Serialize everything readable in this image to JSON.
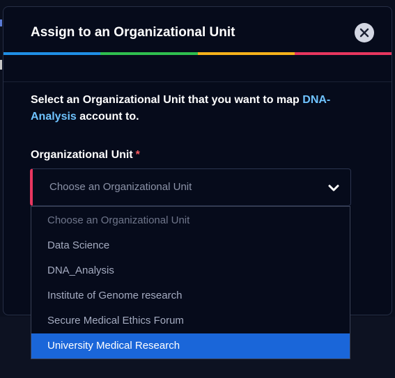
{
  "modal": {
    "title": "Assign to an Organizational Unit",
    "close_icon": "close-icon",
    "accent_colors": [
      "#1f8fe6",
      "#2fbf4f",
      "#f5b21b",
      "#e8365f"
    ],
    "description_prefix": "Select an Organizational Unit that you want to map ",
    "account_name": "DNA-Analysis",
    "description_suffix": " account to."
  },
  "field": {
    "label": "Organizational Unit",
    "required_mark": "*",
    "select_value": "Choose an Organizational Unit",
    "chevron_icon": "chevron-down-icon"
  },
  "dropdown": {
    "options": [
      "Choose an Organizational Unit",
      "Data Science",
      "DNA_Analysis",
      "Institute of Genome research",
      "Secure Medical Ethics Forum",
      "University Medical Research"
    ],
    "highlighted_option": "University Medical Research",
    "highlight_color": "#1a66d9"
  }
}
